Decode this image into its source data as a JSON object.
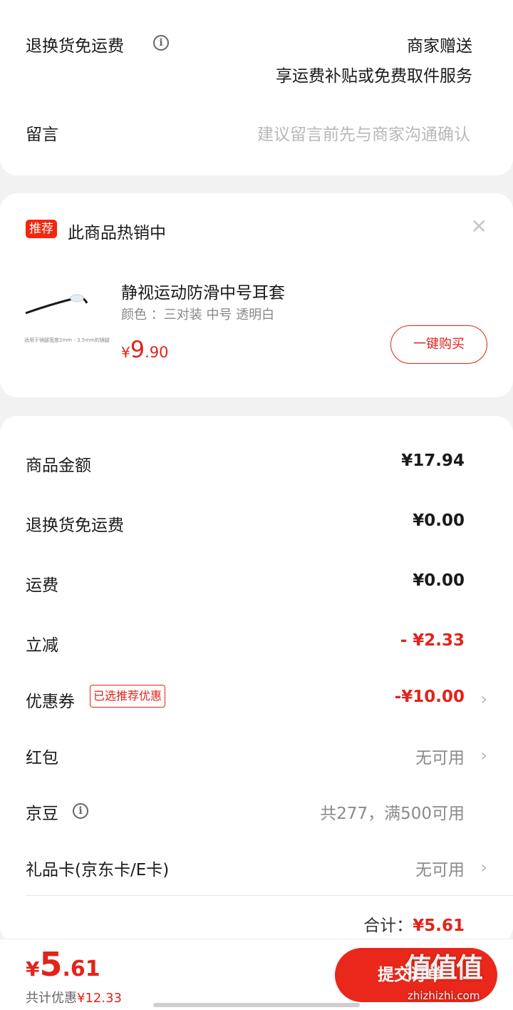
{
  "return_shipping": {
    "label": "退换货免运费",
    "value_line1": "商家赠送",
    "value_line2": "享运费补贴或免费取件服务"
  },
  "message": {
    "label": "留言",
    "placeholder": "建议留言前先与商家沟通确认"
  },
  "recommend": {
    "tag": "推荐",
    "title": "此商品热销中",
    "product_name": "静视运动防滑中号耳套",
    "product_spec": "颜色 ：三对装  中号  透明白",
    "price_yen": "¥",
    "price_int": "9",
    "price_dec": ".90",
    "buy_button": "一键购买",
    "image_caption": "适用于镜腿宽度2mm - 3.5mm的镜腿"
  },
  "summary": {
    "goods_amount": {
      "label": "商品金额",
      "value": "¥17.94"
    },
    "return_fee": {
      "label": "退换货免运费",
      "value": "¥0.00"
    },
    "shipping": {
      "label": "运费",
      "value": "¥0.00"
    },
    "instant_discount": {
      "label": "立减",
      "value": "- ¥2.33"
    },
    "coupon": {
      "label": "优惠券",
      "tag": "已选推荐优惠",
      "value": "-¥10.00"
    },
    "red_packet": {
      "label": "红包",
      "value": "无可用"
    },
    "jingdou": {
      "label": "京豆",
      "value": "共277，满500可用"
    },
    "gift_card": {
      "label": "礼品卡(京东卡/E卡)",
      "value": "无可用"
    },
    "total_label": "合计：",
    "total_value": "¥5.61"
  },
  "bottom_bar": {
    "price_yen": "¥",
    "price_int": "5",
    "price_dec": ".61",
    "saving_label": "共计优惠",
    "saving_value": "¥12.33",
    "submit_label": "提交订单"
  },
  "watermark": {
    "text": "值值值",
    "url": "zhizhizhi.com"
  },
  "colors": {
    "accent_red": "#e2231a",
    "submit_bg": "#e9271a",
    "page_bg": "#f2f2f2"
  },
  "icons": [
    "info-icon",
    "close-icon",
    "chevron-right-icon"
  ]
}
